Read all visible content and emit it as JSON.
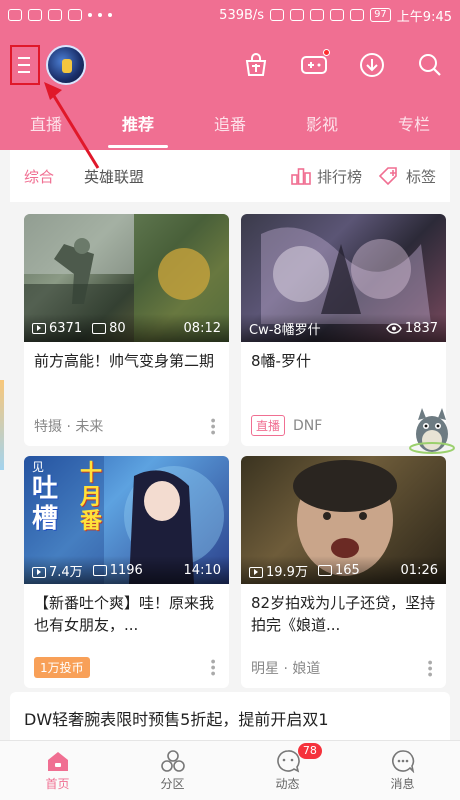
{
  "status_bar": {
    "speed": "539B/s",
    "battery": "97",
    "time": "上午9:45"
  },
  "header": {
    "tabs": [
      "直播",
      "推荐",
      "追番",
      "影视",
      "专栏"
    ],
    "active_tab": "推荐",
    "accent": "#f06f92"
  },
  "subnav": {
    "items": [
      "综合",
      "英雄联盟"
    ],
    "rank_label": "排行榜",
    "tags_label": "标签"
  },
  "cards": [
    {
      "plays": "6371",
      "danmaku": "80",
      "duration": "08:12",
      "title": "前方高能！帅气变身第二期",
      "tag": "特摄 · 未来"
    },
    {
      "overlay_left": "Cw-8幡罗什",
      "viewers": "1837",
      "title": "8幡-罗什",
      "live_label": "直播",
      "category": "DNF"
    },
    {
      "plays": "7.4万",
      "danmaku": "1196",
      "duration": "14:10",
      "title": "【新番吐个爽】哇！原来我也有女朋友，...",
      "coin_tag": "1万投币",
      "thumb_text": [
        "十月番",
        "吐槽",
        "见"
      ]
    },
    {
      "plays": "19.9万",
      "danmaku": "165",
      "duration": "01:26",
      "title": "82岁拍戏为儿子还贷，坚持拍完《娘道...",
      "tag": "明星 · 娘道"
    }
  ],
  "ad": {
    "text": "DW轻奢腕表限时预售5折起，提前开启双1"
  },
  "bottom_nav": {
    "items": [
      "首页",
      "分区",
      "动态",
      "消息"
    ],
    "active": "首页",
    "badge": "78"
  }
}
